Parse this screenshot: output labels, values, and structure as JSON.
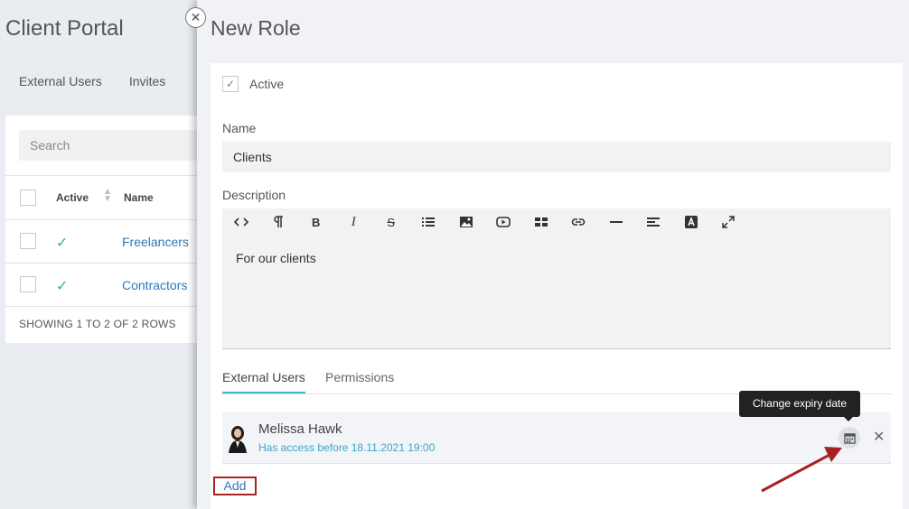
{
  "background": {
    "app_title": "Client Portal",
    "tabs": [
      "External Users",
      "Invites"
    ],
    "search_placeholder": "Search",
    "columns": {
      "active": "Active",
      "name": "Name"
    },
    "rows": [
      {
        "name": "Freelancers",
        "active": true
      },
      {
        "name": "Contractors",
        "active": true
      }
    ],
    "footer": "SHOWING 1 TO 2 OF 2 ROWS"
  },
  "panel": {
    "title": "New Role",
    "close_icon": "close-icon",
    "active_label": "Active",
    "active_checked": true,
    "name_label": "Name",
    "name_value": "Clients",
    "description_label": "Description",
    "description_value": "For our clients",
    "toolbar": [
      "code-view-icon",
      "paragraph-icon",
      "bold-icon",
      "italic-icon",
      "strikethrough-icon",
      "list-icon",
      "image-icon",
      "video-icon",
      "table-icon",
      "link-icon",
      "horizontal-rule-icon",
      "align-icon",
      "text-color-icon",
      "fullscreen-icon"
    ],
    "tabs": [
      {
        "label": "External Users",
        "active": true
      },
      {
        "label": "Permissions",
        "active": false
      }
    ],
    "users": [
      {
        "name": "Melissa Hawk",
        "access": "Has access before 18.11.2021 19:00"
      }
    ],
    "tooltip": "Change expiry date",
    "add_label": "Add"
  },
  "colors": {
    "accent": "#3ab7c9",
    "link": "#2f78b8",
    "annotation": "#a82222",
    "check": "#26b7a3"
  }
}
